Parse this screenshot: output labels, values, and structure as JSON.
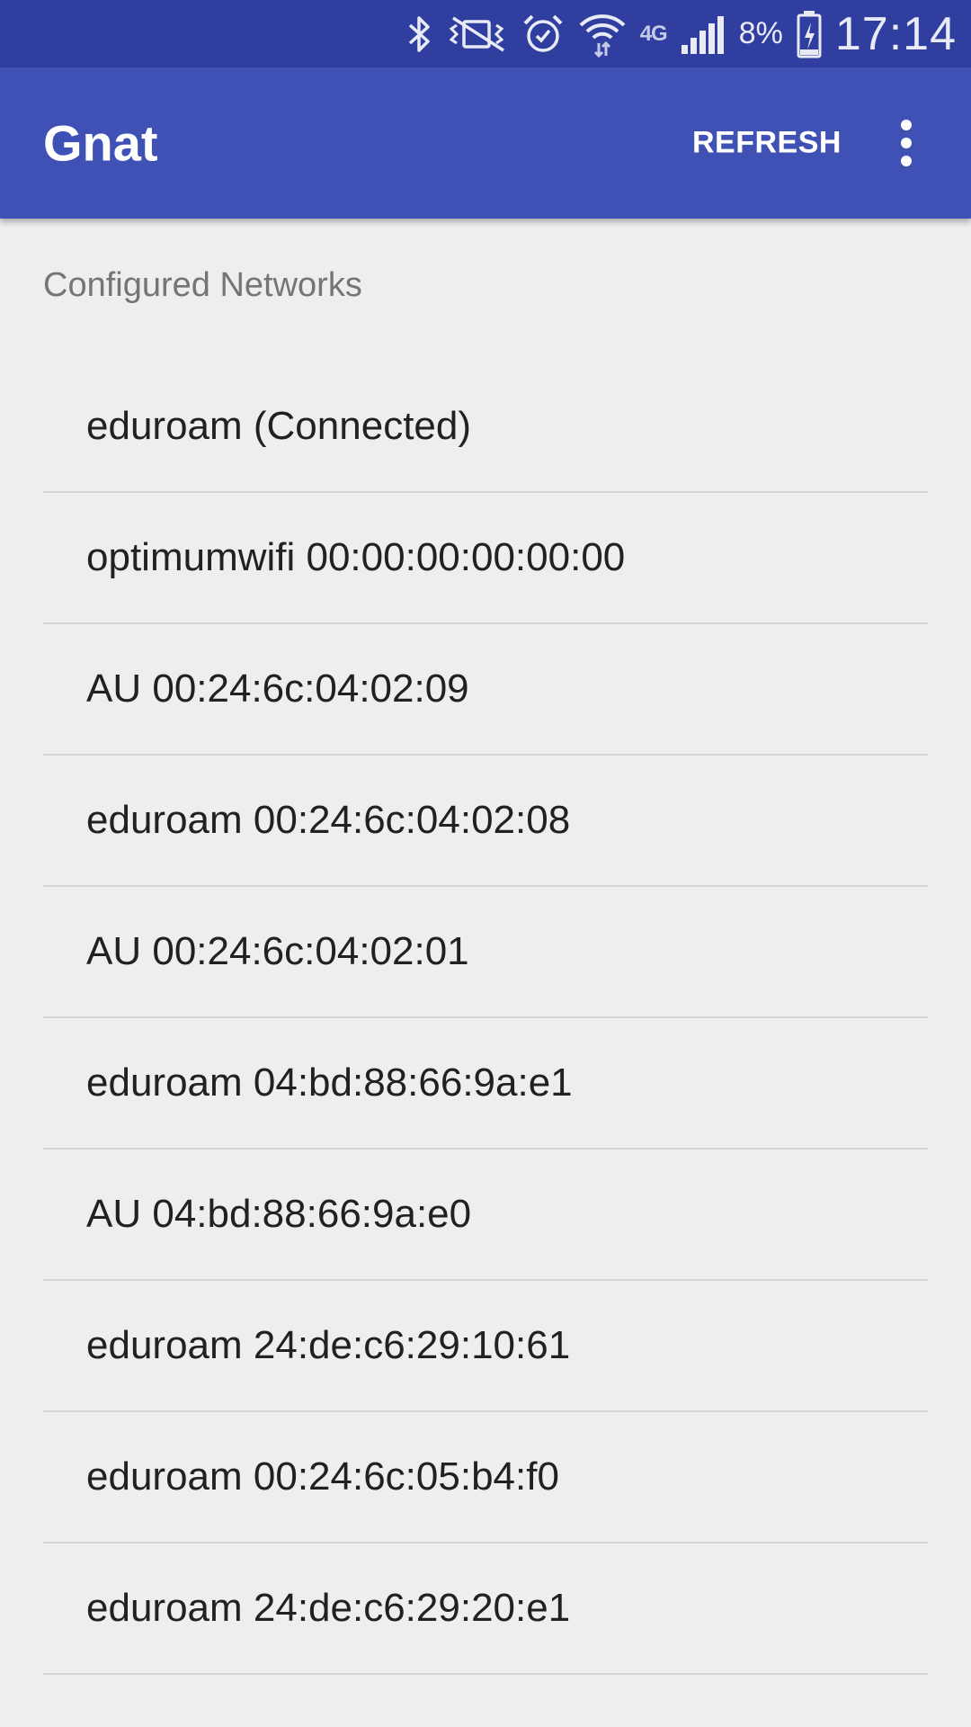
{
  "status_bar": {
    "icons": [
      "bluetooth-icon",
      "vibrate-mute-icon",
      "alarm-icon",
      "wifi-icon",
      "4g-lte-icon",
      "signal-icon"
    ],
    "network_label": "4G",
    "battery_percent": "8%",
    "time": "17:14",
    "background": "#303f9f"
  },
  "app_bar": {
    "title": "Gnat",
    "refresh_label": "REFRESH",
    "menu_icon": "more-vert-icon",
    "background": "#3f51b5"
  },
  "content": {
    "section_title": "Configured Networks",
    "networks": [
      "eduroam (Connected)",
      "optimumwifi 00:00:00:00:00:00",
      "AU 00:24:6c:04:02:09",
      "eduroam 00:24:6c:04:02:08",
      "AU 00:24:6c:04:02:01",
      "eduroam 04:bd:88:66:9a:e1",
      "AU 04:bd:88:66:9a:e0",
      "eduroam 24:de:c6:29:10:61",
      "eduroam 00:24:6c:05:b4:f0",
      "eduroam 24:de:c6:29:20:e1"
    ]
  }
}
